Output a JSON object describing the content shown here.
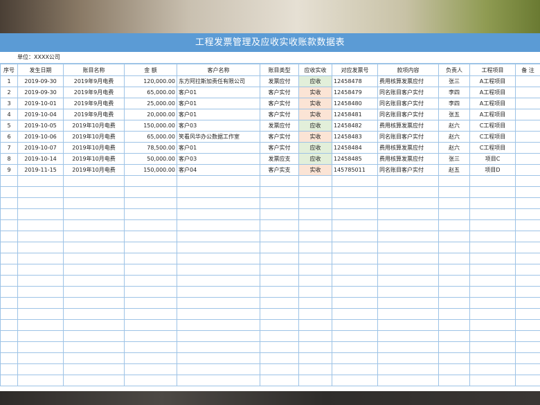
{
  "title": "工程发票管理及应收实收账款数据表",
  "unit_label": "单位：XXXX公司",
  "columns": [
    "序号",
    "发生日期",
    "账目名称",
    "金  额",
    "客户名称",
    "账目类型",
    "应收实收",
    "对应发票号",
    "款项内容",
    "负责人",
    "工程项目",
    "备  注"
  ],
  "rows": [
    {
      "no": "1",
      "date": "2019-09-30",
      "account": "2019年9月电费",
      "amount": "120,000.00",
      "customer": "东方阿拉斯加责任有限公司",
      "type": "发票应付",
      "status": "应收",
      "invoice": "12458478",
      "content": "费用核算发票应付",
      "owner": "张三",
      "project": "A工程项目",
      "note": ""
    },
    {
      "no": "2",
      "date": "2019-09-30",
      "account": "2019年9月电费",
      "amount": "65,000.00",
      "customer": "客户01",
      "type": "客户实付",
      "status": "实收",
      "invoice": "12458479",
      "content": "同名账目客户实付",
      "owner": "李四",
      "project": "A工程项目",
      "note": ""
    },
    {
      "no": "3",
      "date": "2019-10-01",
      "account": "2019年9月电费",
      "amount": "25,000.00",
      "customer": "客户01",
      "type": "客户实付",
      "status": "实收",
      "invoice": "12458480",
      "content": "同名账目客户实付",
      "owner": "李四",
      "project": "A工程项目",
      "note": ""
    },
    {
      "no": "4",
      "date": "2019-10-04",
      "account": "2019年9月电费",
      "amount": "20,000.00",
      "customer": "客户01",
      "type": "客户实付",
      "status": "实收",
      "invoice": "12458481",
      "content": "同名账目客户实付",
      "owner": "张五",
      "project": "A工程项目",
      "note": ""
    },
    {
      "no": "5",
      "date": "2019-10-05",
      "account": "2019年10月电费",
      "amount": "150,000.00",
      "customer": "客户03",
      "type": "发票应付",
      "status": "应收",
      "invoice": "12458482",
      "content": "费用核算发票应付",
      "owner": "赵六",
      "project": "C工程项目",
      "note": ""
    },
    {
      "no": "6",
      "date": "2019-10-06",
      "account": "2019年10月电费",
      "amount": "65,000.00",
      "customer": "笑看风华办公数据工作室",
      "type": "客户实付",
      "status": "实收",
      "invoice": "12458483",
      "content": "同名账目客户实付",
      "owner": "赵六",
      "project": "C工程项目",
      "note": ""
    },
    {
      "no": "7",
      "date": "2019-10-07",
      "account": "2019年10月电费",
      "amount": "78,500.00",
      "customer": "客户01",
      "type": "客户实付",
      "status": "应收",
      "invoice": "12458484",
      "content": "费用核算发票应付",
      "owner": "赵六",
      "project": "C工程项目",
      "note": ""
    },
    {
      "no": "8",
      "date": "2019-10-14",
      "account": "2019年10月电费",
      "amount": "50,000.00",
      "customer": "客户03",
      "type": "发票应支",
      "status": "应收",
      "invoice": "12458485",
      "content": "费用核算发票应付",
      "owner": "张三",
      "project": "项目C",
      "note": ""
    },
    {
      "no": "9",
      "date": "2019-11-15",
      "account": "2019年10月电费",
      "amount": "150,000.00",
      "customer": "客户04",
      "type": "客户实支",
      "status": "实收",
      "invoice": "145785011",
      "content": "同名账目客户实付",
      "owner": "赵五",
      "project": "项目D",
      "note": ""
    }
  ],
  "colors": {
    "title_bg": "#5b9bd5",
    "grid": "#9dc3e6",
    "receivable_bg": "#e2efda",
    "received_bg": "#fbe4d5"
  }
}
